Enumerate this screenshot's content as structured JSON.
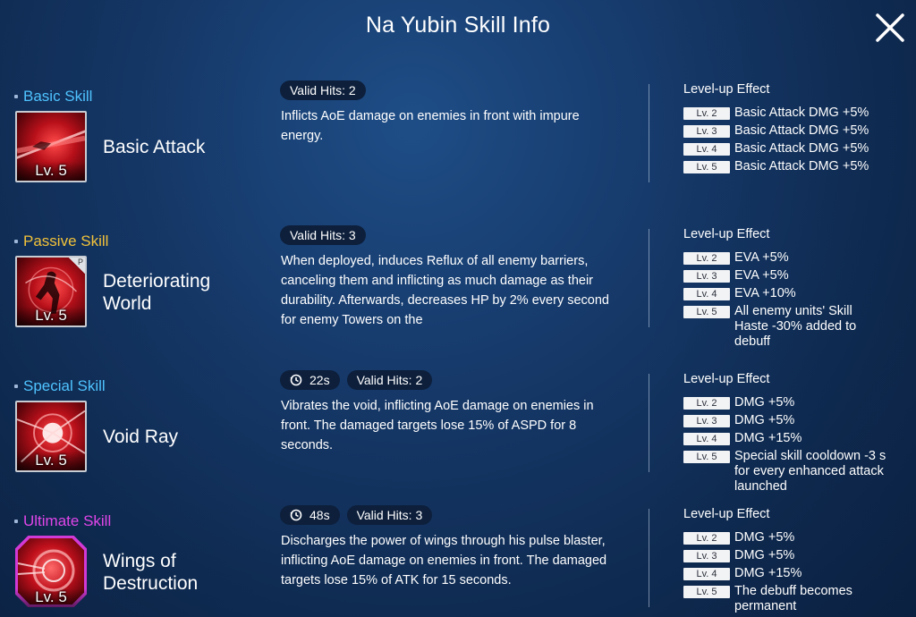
{
  "header": {
    "title": "Na Yubin Skill Info"
  },
  "level_up_label": "Level-up Effect",
  "skills": [
    {
      "category": "Basic Skill",
      "category_color": "#4fc3ff",
      "name": "Basic Attack",
      "level": "Lv. 5",
      "cooldown": "",
      "valid_hits": "Valid Hits: 2",
      "description": "Inflicts AoE damage on enemies in front with impure energy.",
      "effects": [
        {
          "lv": "Lv. 2",
          "text": "Basic Attack DMG +5%"
        },
        {
          "lv": "Lv. 3",
          "text": "Basic Attack DMG +5%"
        },
        {
          "lv": "Lv. 4",
          "text": "Basic Attack DMG +5%"
        },
        {
          "lv": "Lv. 5",
          "text": "Basic Attack DMG +5%"
        }
      ]
    },
    {
      "category": "Passive Skill",
      "category_color": "#f2c23a",
      "name": "Deteriorating World",
      "level": "Lv. 5",
      "passive_badge": "P",
      "cooldown": "",
      "valid_hits": "Valid Hits: 3",
      "description": "When deployed, induces Reflux of all enemy barriers, canceling them and inflicting as much damage as their durability. Afterwards, decreases HP by 2% every second for enemy Towers on the",
      "effects": [
        {
          "lv": "Lv. 2",
          "text": "EVA +5%"
        },
        {
          "lv": "Lv. 3",
          "text": "EVA +5%"
        },
        {
          "lv": "Lv. 4",
          "text": "EVA +10%"
        },
        {
          "lv": "Lv. 5",
          "text": "All enemy units' Skill Haste -30% added to debuff"
        }
      ]
    },
    {
      "category": "Special Skill",
      "category_color": "#4fc3ff",
      "name": "Void Ray",
      "level": "Lv. 5",
      "cooldown": "22s",
      "valid_hits": "Valid Hits: 2",
      "description": "Vibrates the void, inflicting AoE damage on enemies in front. The damaged targets lose 15% of ASPD for 8 seconds.",
      "effects": [
        {
          "lv": "Lv. 2",
          "text": "DMG +5%"
        },
        {
          "lv": "Lv. 3",
          "text": "DMG +5%"
        },
        {
          "lv": "Lv. 4",
          "text": "DMG +15%"
        },
        {
          "lv": "Lv. 5",
          "text": "Special skill cooldown -3 s for every enhanced attack launched"
        }
      ]
    },
    {
      "category": "Ultimate Skill",
      "category_color": "#e046e8",
      "name": "Wings of Destruction",
      "level": "Lv. 5",
      "cooldown": "48s",
      "valid_hits": "Valid Hits: 3",
      "description": "Discharges the power of wings through his pulse blaster, inflicting AoE damage on enemies in front. The damaged targets lose 15% of ATK for 15 seconds.",
      "effects": [
        {
          "lv": "Lv. 2",
          "text": "DMG +5%"
        },
        {
          "lv": "Lv. 3",
          "text": "DMG +5%"
        },
        {
          "lv": "Lv. 4",
          "text": "DMG +15%"
        },
        {
          "lv": "Lv. 5",
          "text": "The debuff becomes permanent"
        }
      ]
    }
  ]
}
